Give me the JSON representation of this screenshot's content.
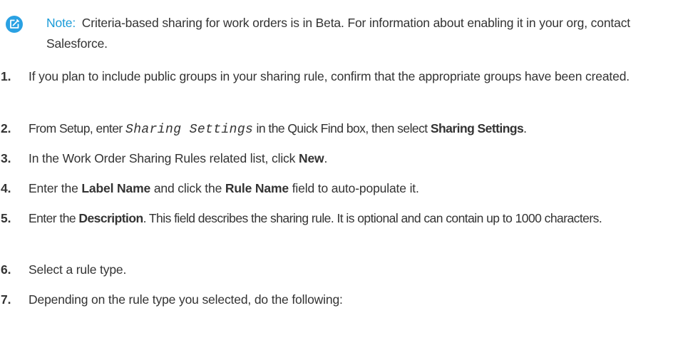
{
  "note": {
    "icon": "edit-icon",
    "label": "Note:",
    "text": "Criteria-based sharing for work orders is in Beta. For information about enabling it in your org, contact Salesforce.",
    "label_color": "#1a9bd8",
    "icon_color": "#2aa1e3"
  },
  "steps": [
    {
      "num": "1.",
      "t1": "If you plan to include public groups in your sharing rule, confirm that the appropriate groups have been created."
    },
    {
      "num": "2.",
      "t1": "From Setup, enter ",
      "code": "Sharing Settings",
      "t2": " in the Quick Find box, then select ",
      "b1": "Sharing Settings",
      "t3": "."
    },
    {
      "num": "3.",
      "t1": "In the Work Order Sharing Rules related list, click ",
      "b1": "New",
      "t2": "."
    },
    {
      "num": "4.",
      "t1": "Enter the ",
      "b1": "Label Name",
      "t2": " and click the ",
      "b2": "Rule Name",
      "t3": " field to auto-populate it."
    },
    {
      "num": "5.",
      "t1": "Enter the ",
      "b1": "Description",
      "t2": ". This field describes the sharing rule. It is optional and can contain up to 1000 characters."
    },
    {
      "num": "6.",
      "t1": "Select a rule type."
    },
    {
      "num": "7.",
      "t1": "Depending on the rule type you selected, do the following:"
    }
  ]
}
